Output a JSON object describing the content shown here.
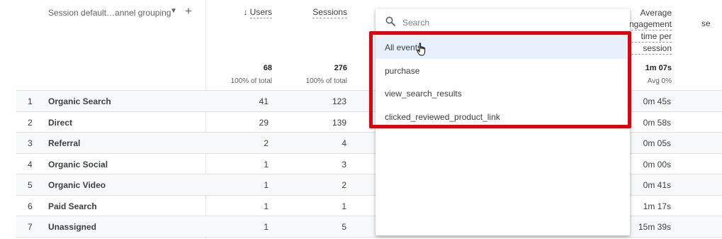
{
  "header": {
    "dimension_label": "Session default…annel grouping",
    "columns": [
      {
        "label": "Users",
        "sorted": true,
        "total": "68",
        "sub": "100% of total"
      },
      {
        "label": "Sessions",
        "total": "276",
        "sub": "100% of total"
      },
      {
        "label_lines": [
          "Average",
          "engagement",
          "time per",
          "session"
        ],
        "total": "1m 07s",
        "sub": "Avg 0%"
      }
    ],
    "clipped_right_label": "se"
  },
  "rows": [
    {
      "index": "1",
      "channel": "Organic Search",
      "users": "41",
      "sessions": "123",
      "avg_time": "0m 45s"
    },
    {
      "index": "2",
      "channel": "Direct",
      "users": "29",
      "sessions": "139",
      "avg_time": "0m 58s"
    },
    {
      "index": "3",
      "channel": "Referral",
      "users": "2",
      "sessions": "4",
      "avg_time": "0m 05s"
    },
    {
      "index": "4",
      "channel": "Organic Social",
      "users": "1",
      "sessions": "3",
      "avg_time": "0m 00s"
    },
    {
      "index": "5",
      "channel": "Organic Video",
      "users": "1",
      "sessions": "2",
      "avg_time": "0m 41s"
    },
    {
      "index": "6",
      "channel": "Paid Search",
      "users": "1",
      "sessions": "1",
      "avg_time": "1m 17s"
    },
    {
      "index": "7",
      "channel": "Unassigned",
      "users": "1",
      "sessions": "5",
      "avg_time": "15m 39s"
    }
  ],
  "dropdown": {
    "search_placeholder": "Search",
    "options": [
      "All events",
      "purchase",
      "view_search_results",
      "clicked_reviewed_product_link"
    ],
    "selected_index": 0
  },
  "colors": {
    "highlight": "#e2000f",
    "selected_option_bg": "#e8f0fe"
  }
}
